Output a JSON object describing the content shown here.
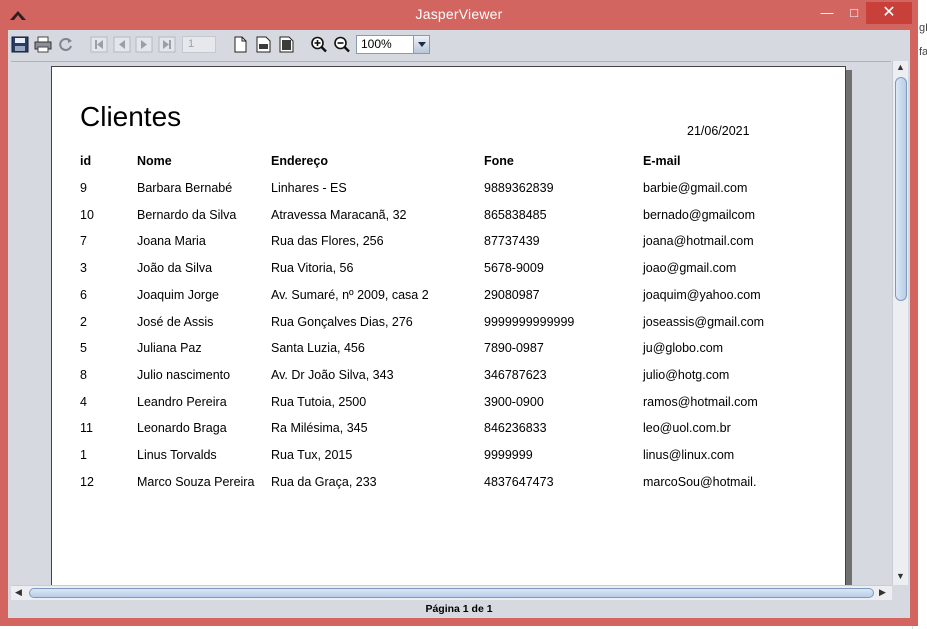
{
  "window": {
    "title": "JasperViewer",
    "minimize_glyph": "—",
    "maximize_glyph": "□",
    "close_glyph": "✕"
  },
  "background_strip": {
    "fragment_1": "gE",
    "fragment_2": "fa"
  },
  "toolbar": {
    "icons": [
      "save-icon",
      "print-icon",
      "reload-icon",
      "first-page-icon",
      "previous-page-icon",
      "next-page-icon",
      "last-page-icon",
      "actual-size-icon",
      "fit-width-icon",
      "fit-page-icon",
      "zoom-in-icon",
      "zoom-out-icon"
    ],
    "page_number": "1",
    "zoom_value": "100%"
  },
  "report": {
    "title": "Clientes",
    "date": "21/06/2021",
    "columns": [
      "id",
      "Nome",
      "Endereço",
      "Fone",
      "E-mail"
    ],
    "rows": [
      [
        "9",
        "Barbara Bernabé",
        "Linhares - ES",
        "9889362839",
        "barbie@gmail.com"
      ],
      [
        "10",
        "Bernardo da Silva",
        "Atravessa Maracanã, 32",
        "865838485",
        "bernado@gmailcom"
      ],
      [
        "7",
        "Joana Maria",
        "Rua das Flores, 256",
        "87737439",
        "joana@hotmail.com"
      ],
      [
        "3",
        "João da Silva",
        "Rua Vitoria, 56",
        "5678-9009",
        "joao@gmail.com"
      ],
      [
        "6",
        "Joaquim Jorge",
        "Av. Sumaré, nº 2009, casa 2",
        "29080987",
        "joaquim@yahoo.com"
      ],
      [
        "2",
        "José de Assis",
        "Rua Gonçalves Dias, 276",
        "9999999999999",
        "joseassis@gmail.com"
      ],
      [
        "5",
        "Juliana Paz",
        "Santa Luzia, 456",
        "7890-0987",
        "ju@globo.com"
      ],
      [
        "8",
        "Julio nascimento",
        "Av. Dr João Silva, 343",
        "346787623",
        "julio@hotg.com"
      ],
      [
        "4",
        "Leandro Pereira",
        "Rua Tutoia, 2500",
        "3900-0900",
        "ramos@hotmail.com"
      ],
      [
        "11",
        "Leonardo Braga",
        "Ra Milésima, 345",
        "846236833",
        "leo@uol.com.br"
      ],
      [
        "1",
        "Linus Torvalds",
        "Rua Tux, 2015",
        "9999999",
        "linus@linux.com"
      ],
      [
        "12",
        "Marco Souza Pereira",
        "Rua da Graça, 233",
        "4837647473",
        "marcoSou@hotmail."
      ]
    ]
  },
  "status": {
    "page_indicator": "Página 1 de 1"
  },
  "colors": {
    "title_bar": "#d26560",
    "close_button": "#c7403a",
    "frame": "#d6d9df"
  }
}
